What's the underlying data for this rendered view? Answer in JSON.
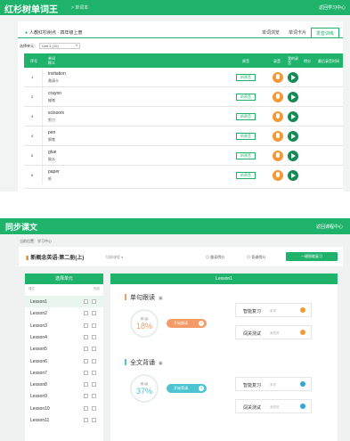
{
  "app1": {
    "title": "红杉树单词王",
    "subtitle": "> 单词本",
    "back_label": "返回学习中心",
    "breadcrumb": "人教红杉树点 · 四年级上册",
    "tabs": [
      {
        "label": "单词浏览"
      },
      {
        "label": "单词卡片"
      },
      {
        "label": "发音训练"
      }
    ],
    "unit_select_label": "选择单元：",
    "unit_select_value": "Unit 1 (10)",
    "columns": {
      "index": "序号",
      "word": "单词",
      "meaning": "释义",
      "original": "原音",
      "record": "录音",
      "my_record": "我的录音",
      "score": "得分",
      "last_time": "最后录音时间"
    },
    "audio_button_label": "听原音",
    "rows": [
      {
        "index": "1",
        "word": "invitation",
        "meaning": "邀请卡"
      },
      {
        "index": "2",
        "word": "crayon",
        "meaning": "蜡笔"
      },
      {
        "index": "3",
        "word": "scissors",
        "meaning": "剪刀"
      },
      {
        "index": "4",
        "word": "pen",
        "meaning": "钢笔"
      },
      {
        "index": "5",
        "word": "glue",
        "meaning": "胶水"
      },
      {
        "index": "6",
        "word": "paper",
        "meaning": "纸"
      }
    ],
    "colors": {
      "accent": "#1fb26b",
      "mic": "#f39a36",
      "play": "#168a55"
    }
  },
  "app2": {
    "title": "同步课文",
    "back_label": "返回课程中心",
    "location": "当前位置：学习中心",
    "book_title": "新概念英语-第二册(上)",
    "switch_label": "切换课程 ▾",
    "tag_reading": "跟读得分",
    "tag_recite": "背诵得分",
    "one_click_button": "一键智能复习",
    "sidebar_header": "选择单元",
    "sidebar_col_left": "课文",
    "sidebar_col_right": "完成",
    "lessons": [
      {
        "name": "Lesson1",
        "selected": true
      },
      {
        "name": "Lesson2",
        "selected": false
      },
      {
        "name": "Lesson3",
        "selected": false
      },
      {
        "name": "Lesson4",
        "selected": false
      },
      {
        "name": "Lesson5",
        "selected": false
      },
      {
        "name": "Lesson6",
        "selected": false
      },
      {
        "name": "Lesson7",
        "selected": false
      },
      {
        "name": "Lesson8",
        "selected": false
      },
      {
        "name": "Lesson9",
        "selected": false
      },
      {
        "name": "Lesson10",
        "selected": false
      },
      {
        "name": "Lesson11",
        "selected": false
      }
    ],
    "main_header": "Lesson1",
    "sections": [
      {
        "title": "单句跟读",
        "level": "第1级",
        "percent": "18%",
        "action": "开始跟读",
        "color": "#f39a66",
        "chips": [
          {
            "label": "智能复习",
            "status": "未学"
          },
          {
            "label": "闯关测试",
            "status": "未闯关"
          }
        ]
      },
      {
        "title": "全文背诵",
        "level": "第1级",
        "percent": "37%",
        "action": "开始背诵",
        "color": "#4ec3d1",
        "chips": [
          {
            "label": "智能复习",
            "status": "未学"
          },
          {
            "label": "闯关测试",
            "status": "未闯关"
          }
        ]
      }
    ]
  }
}
